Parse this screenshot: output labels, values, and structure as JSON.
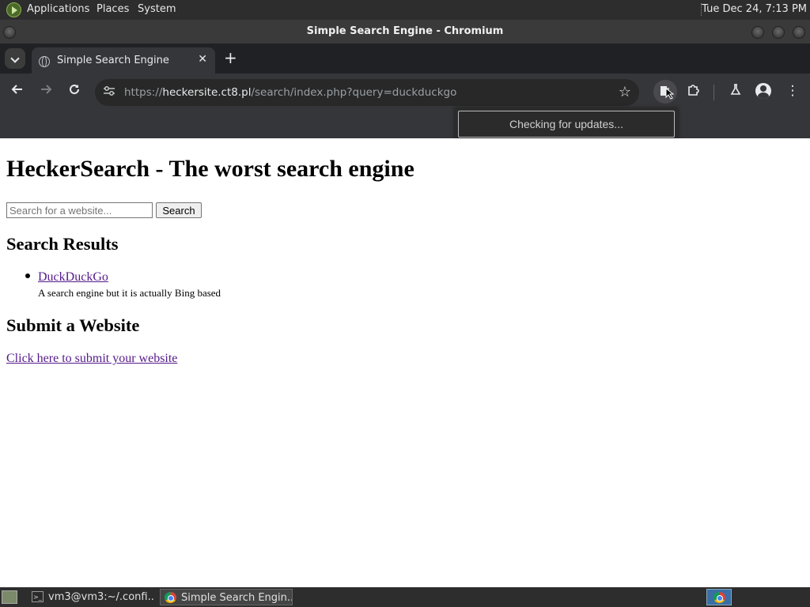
{
  "desktop": {
    "menus": [
      "Applications",
      "Places",
      "System"
    ],
    "clock": "Tue Dec 24,  7:13 PM"
  },
  "window": {
    "title": "Simple Search Engine - Chromium"
  },
  "browser": {
    "tab_title": "Simple Search Engine",
    "tab_close": "✕",
    "new_tab": "+",
    "url_scheme": "https://",
    "url_host": "heckersite.ct8.pl",
    "url_path": "/search/index.php?query=duckduckgo",
    "popup_text": "Checking for updates..."
  },
  "page": {
    "heading": "HeckerSearch - The worst search engine",
    "search_placeholder": "Search for a website...",
    "search_button": "Search",
    "results_heading": "Search Results",
    "results": [
      {
        "title": "DuckDuckGo",
        "description": "A search engine but it is actually Bing based"
      }
    ],
    "submit_heading": "Submit a Website",
    "submit_link": "Click here to submit your website"
  },
  "taskbar": {
    "tasks": [
      {
        "label": "vm3@vm3:~/.confi...",
        "icon": "terminal-icon"
      },
      {
        "label": "Simple Search Engin...",
        "icon": "chromium-icon"
      }
    ]
  }
}
